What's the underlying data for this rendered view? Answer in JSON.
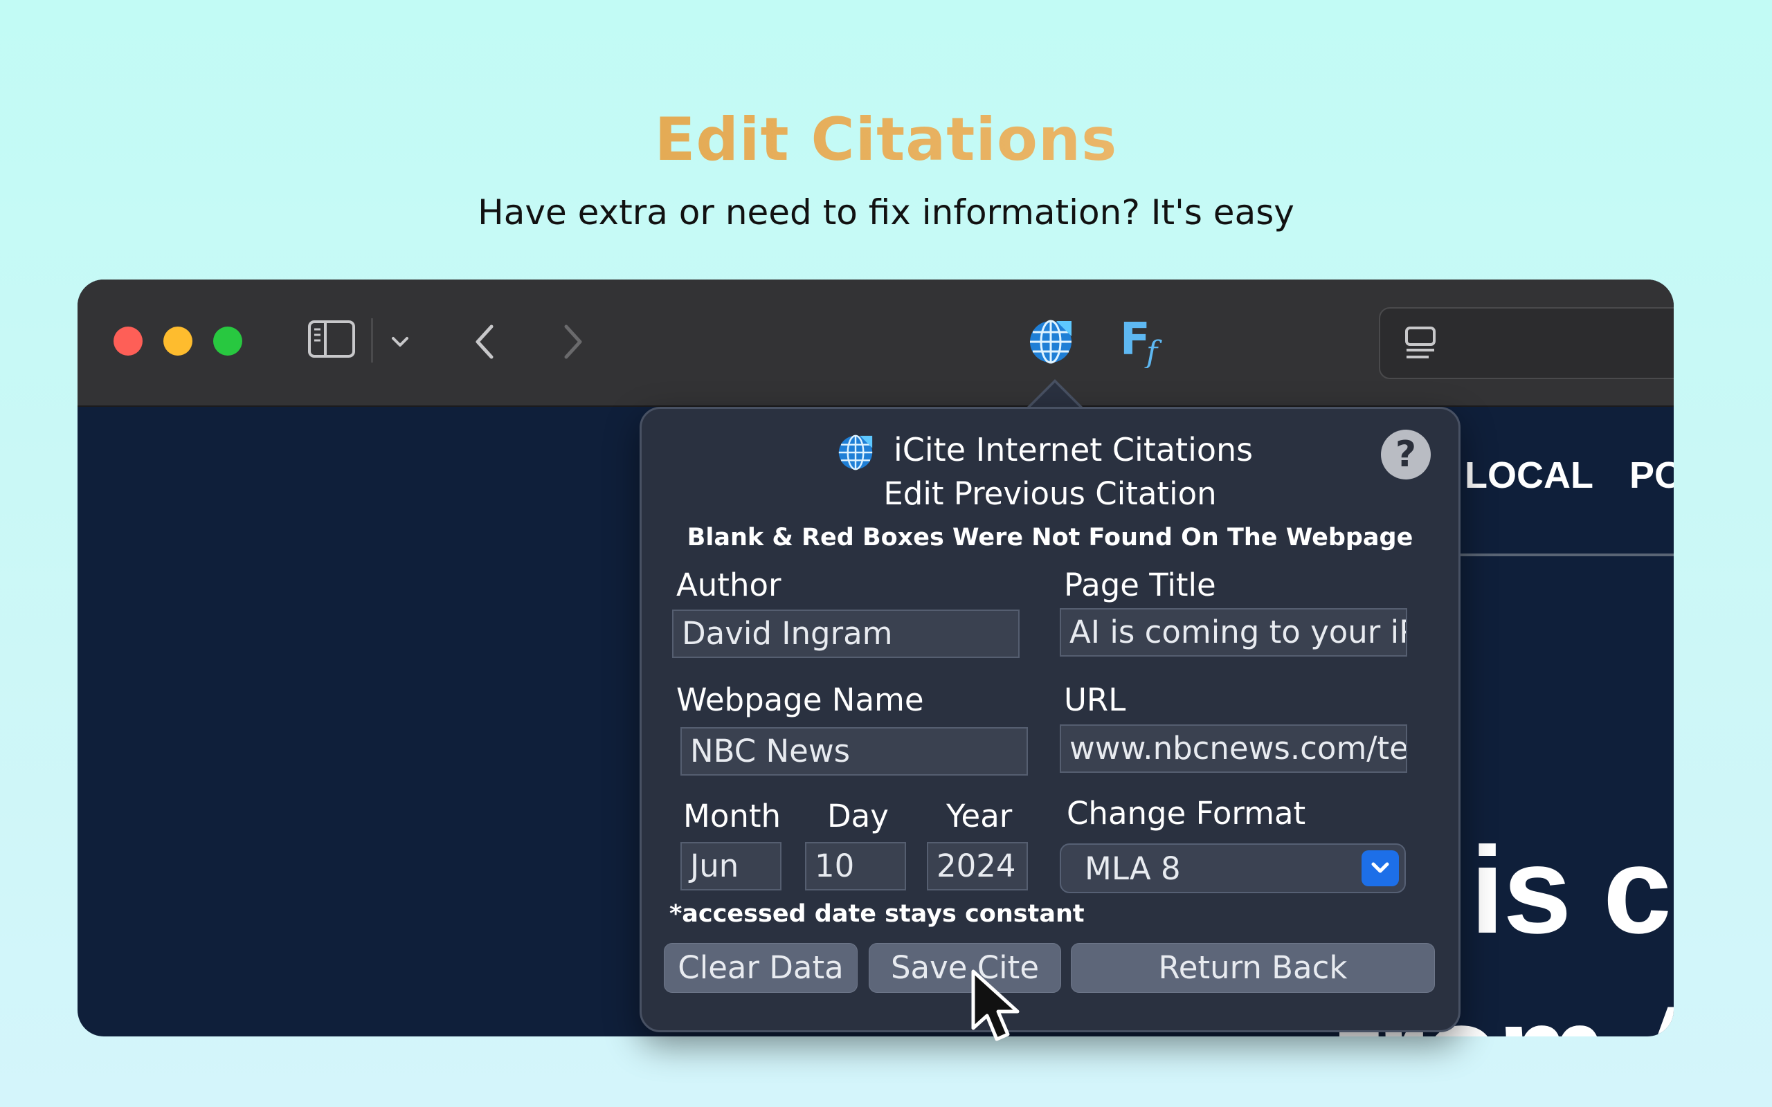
{
  "hero": {
    "title": "Edit Citations",
    "subtitle": "Have extra or need to fix information? It's easy"
  },
  "toolbar": {
    "icons": [
      "sidebar-icon",
      "chevron-down-icon",
      "back-icon",
      "forward-icon",
      "globe-extension-icon",
      "ff-extension-icon",
      "reader-icon"
    ]
  },
  "webpage": {
    "nav_items": [
      "LOCAL",
      "PO"
    ],
    "headline_line1": "is co",
    "headline_line2": "from A"
  },
  "popover": {
    "app_title": "iCite Internet Citations",
    "help_label": "?",
    "subtitle": "Edit Previous Citation",
    "notice": "Blank & Red Boxes Were Not Found On The Webpage",
    "fields": {
      "author": {
        "label": "Author",
        "value": "David Ingram"
      },
      "page_title": {
        "label": "Page Title",
        "value": "AI is coming to your iP"
      },
      "webpage_name": {
        "label": "Webpage Name",
        "value": "NBC News"
      },
      "url": {
        "label": "URL",
        "value": "www.nbcnews.com/tec"
      },
      "month": {
        "label": "Month",
        "value": "Jun"
      },
      "day": {
        "label": "Day",
        "value": "10"
      },
      "year": {
        "label": "Year",
        "value": "2024"
      }
    },
    "format": {
      "label": "Change Format",
      "selected": "MLA 8"
    },
    "accessed_note": "*accessed date stays constant",
    "buttons": {
      "clear": "Clear Data",
      "save": "Save Cite",
      "return": "Return Back"
    }
  },
  "colors": {
    "accent_blue": "#1d6fe8",
    "title_gold": "#dc9c3b",
    "traffic_red": "#fe5f57",
    "traffic_yellow": "#febc2e",
    "traffic_green": "#28c840"
  }
}
